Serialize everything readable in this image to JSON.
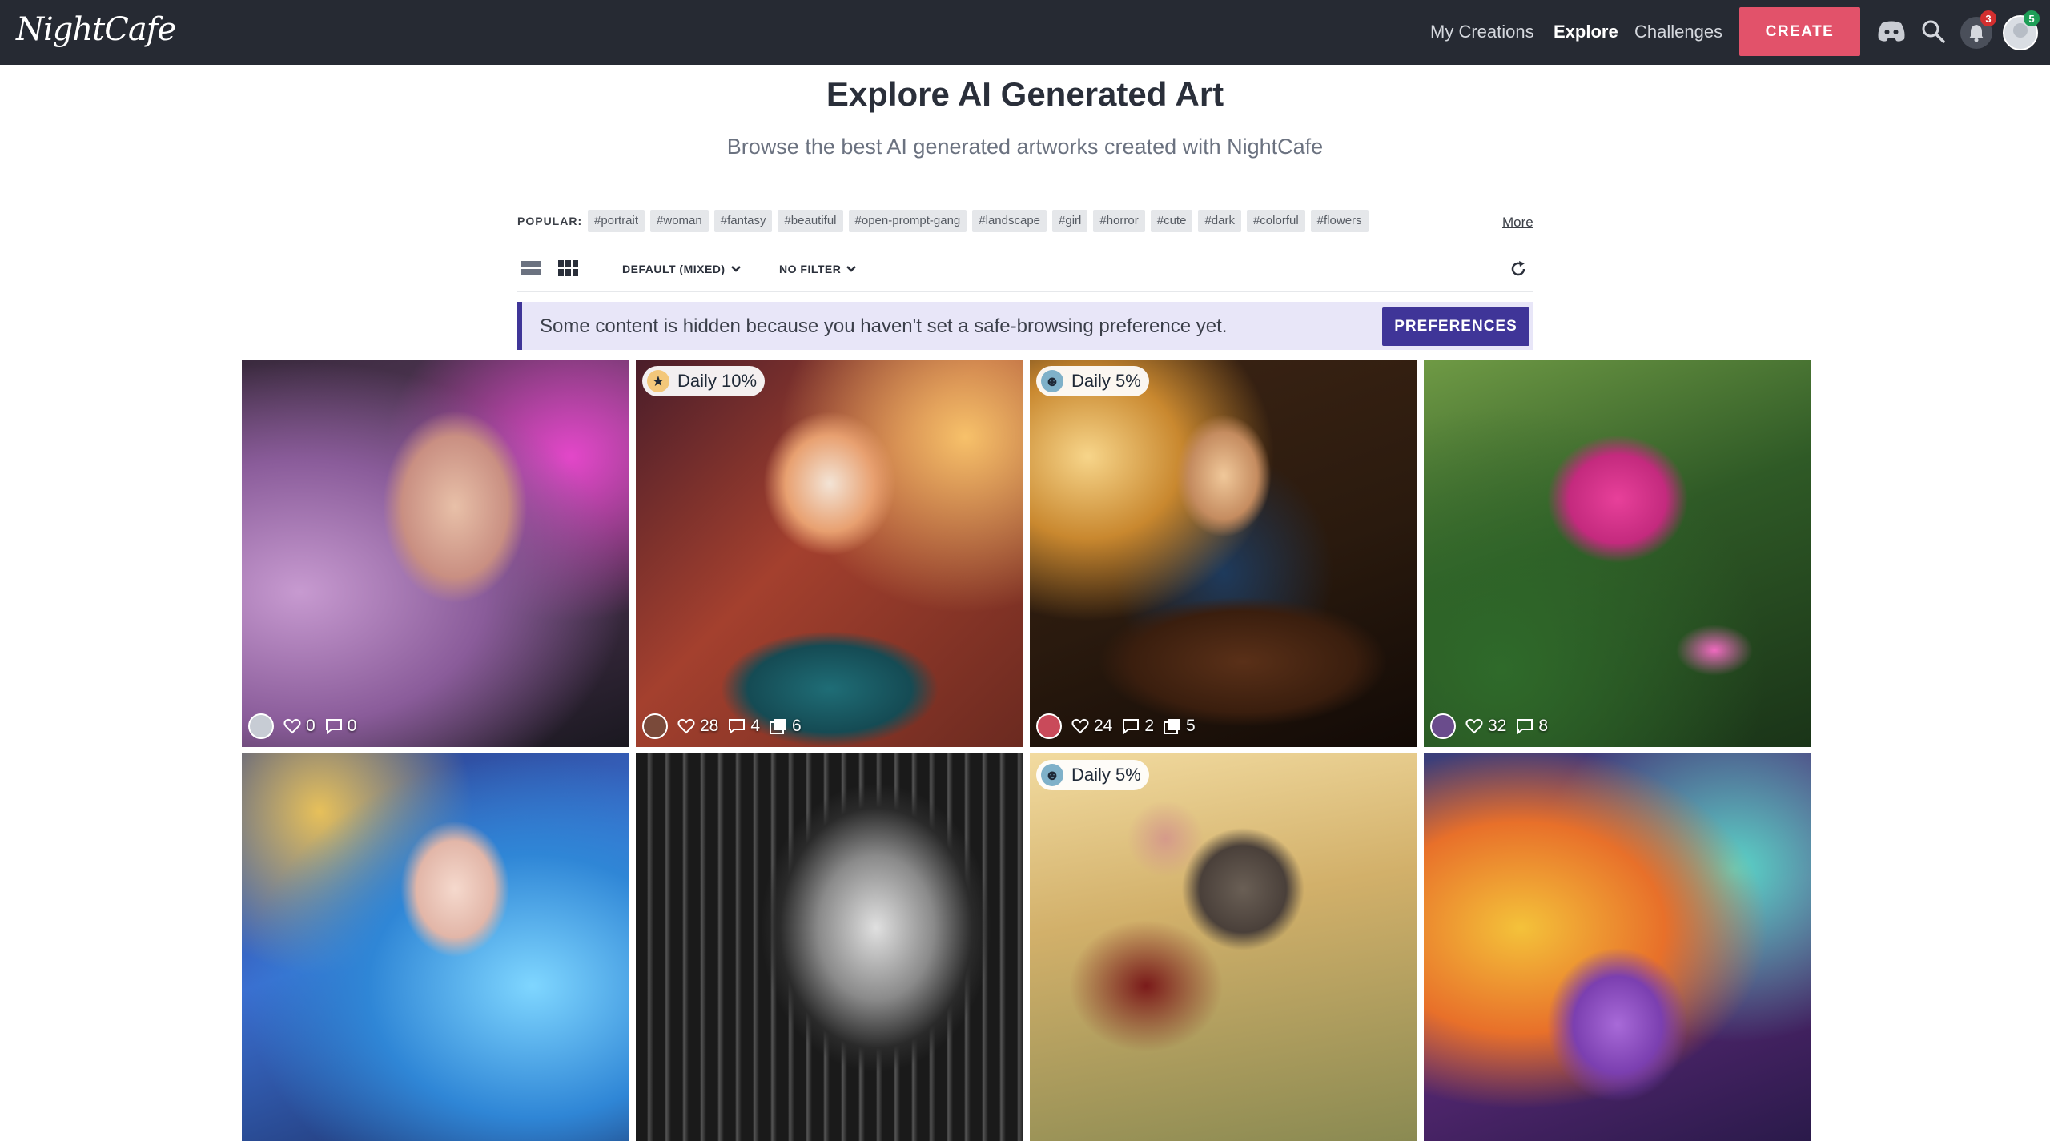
{
  "header": {
    "logo": "NightCafe",
    "nav": [
      "My Creations",
      "Explore",
      "Challenges"
    ],
    "create_label": "CREATE",
    "notifications_count": "3",
    "profile_badge": "5",
    "icons": [
      "discord-icon",
      "search-icon",
      "bell-icon",
      "avatar"
    ]
  },
  "page": {
    "title": "Explore AI Generated Art",
    "subtitle": "Browse the best AI generated artworks created with NightCafe"
  },
  "popular": {
    "label": "POPULAR:",
    "tags": [
      "#portrait",
      "#woman",
      "#fantasy",
      "#beautiful",
      "#open-prompt-gang",
      "#landscape",
      "#girl",
      "#horror",
      "#cute",
      "#dark",
      "#colorful",
      "#flowers"
    ],
    "more": "More"
  },
  "toolbar": {
    "sort": "DEFAULT (MIXED)",
    "filter": "NO FILTER"
  },
  "notice": {
    "text": "Some content is hidden because you haven't set a safe-browsing preference yet.",
    "button": "PREFERENCES"
  },
  "colors": {
    "topbar": "#262a33",
    "create": "#e2526a",
    "preferences": "#3f3598",
    "notice_bg": "#e8e6f8"
  },
  "cards": [
    {
      "badge": "",
      "likes": "0",
      "comments": "0",
      "images": ""
    },
    {
      "badge": "Daily 10%",
      "likes": "28",
      "comments": "4",
      "images": "6"
    },
    {
      "badge": "Daily 5%",
      "likes": "24",
      "comments": "2",
      "images": "5"
    },
    {
      "badge": "",
      "likes": "32",
      "comments": "8",
      "images": ""
    },
    {
      "badge": "",
      "likes": "",
      "comments": "",
      "images": ""
    },
    {
      "badge": "",
      "likes": "",
      "comments": "",
      "images": ""
    },
    {
      "badge": "Daily 5%",
      "likes": "",
      "comments": "",
      "images": ""
    },
    {
      "badge": "",
      "likes": "",
      "comments": "",
      "images": ""
    }
  ]
}
